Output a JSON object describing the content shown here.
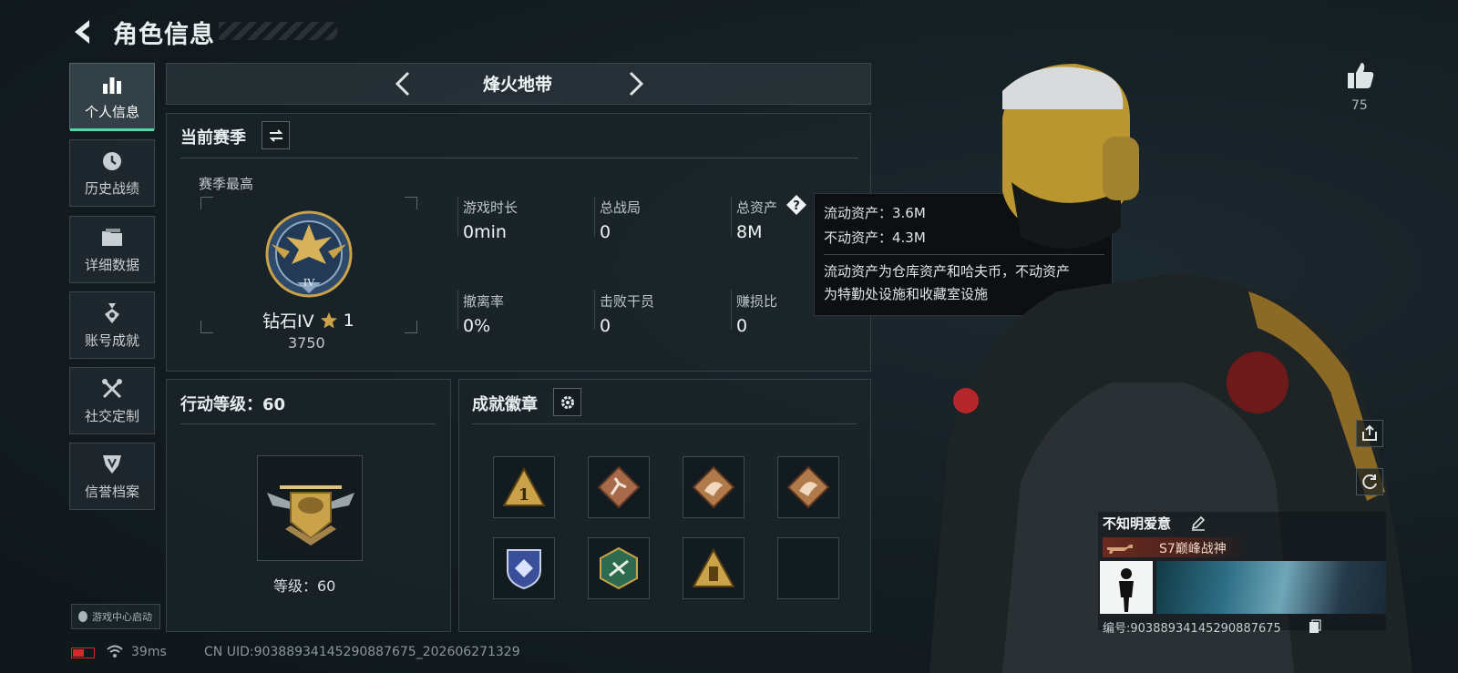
{
  "header": {
    "title": "角色信息"
  },
  "sidebar": {
    "items": [
      {
        "label": "个人信息",
        "icon": "bar-chart-icon",
        "active": true
      },
      {
        "label": "历史战绩",
        "icon": "clock-icon",
        "active": false
      },
      {
        "label": "详细数据",
        "icon": "folder-icon",
        "active": false
      },
      {
        "label": "账号成就",
        "icon": "medal-icon",
        "active": false
      },
      {
        "label": "社交定制",
        "icon": "tools-icon",
        "active": false
      },
      {
        "label": "信誉档案",
        "icon": "shield-icon",
        "active": false
      }
    ],
    "game_center_button": "游戏中心启动"
  },
  "mode_selector": {
    "current": "烽火地带"
  },
  "season": {
    "title": "当前赛季",
    "best_label": "赛季最高",
    "rank_name": "钻石IV",
    "rank_stars": "1",
    "rank_score": "3750",
    "stats": [
      {
        "label": "游戏时长",
        "value": "0min"
      },
      {
        "label": "总战局",
        "value": "0"
      },
      {
        "label": "总资产",
        "value": "8M"
      },
      {
        "label": "撤离率",
        "value": "0%"
      },
      {
        "label": "击败干员",
        "value": "0"
      },
      {
        "label": "赚损比",
        "value": "0"
      }
    ]
  },
  "tooltip": {
    "line1": "流动资产：3.6M",
    "line2": "不动资产：4.3M",
    "desc1": "流动资产为仓库资产和哈夫币，不动资产",
    "desc2": "为特勤处设施和收藏室设施"
  },
  "action_level": {
    "title": "行动等级：60",
    "level_text": "等级：60"
  },
  "achievements": {
    "title": "成就徽章",
    "badge_count": 7,
    "empty_slots": 1
  },
  "likes": {
    "count": "75"
  },
  "player": {
    "name": "不知明爱意",
    "title_badge": "S7巅峰战神",
    "id_text": "编号:9038893414529088767​5"
  },
  "status_bar": {
    "ping": "39ms",
    "uid": "CN UID:9038893414529088767​5_202606271329"
  },
  "colors": {
    "accent": "#4fd6a4",
    "gold": "#c9a24a",
    "bronze": "#b07a4a",
    "battery": "#d12a2a"
  }
}
